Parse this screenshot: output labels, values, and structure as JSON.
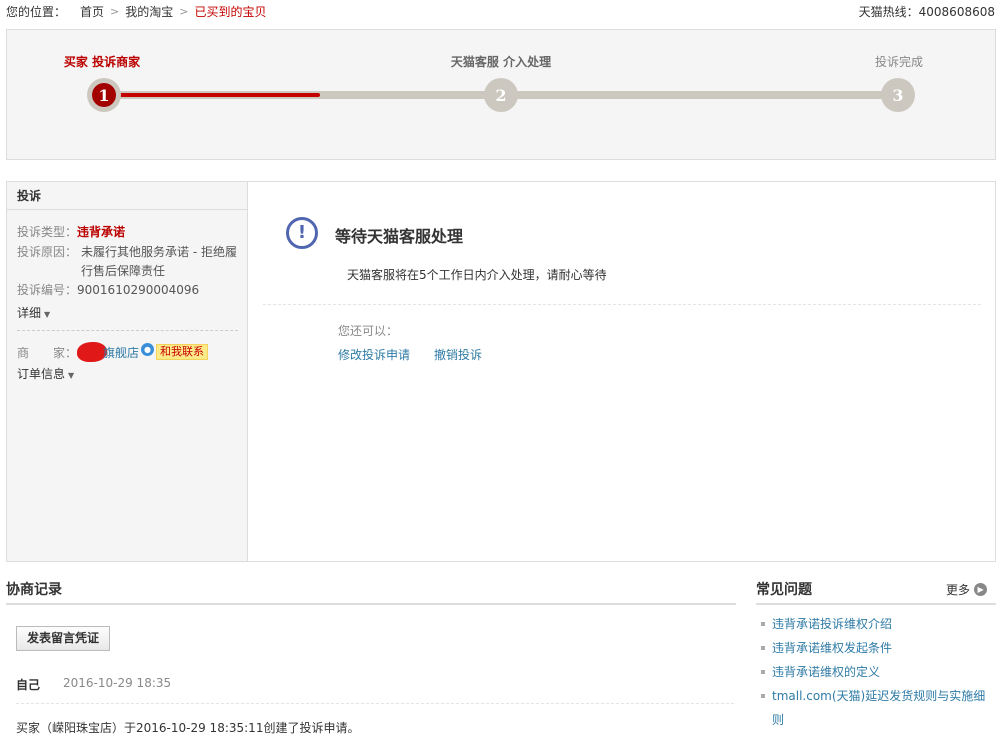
{
  "breadcrumb": {
    "label": "您的位置：",
    "items": [
      "首页",
      "我的淘宝"
    ],
    "current": "已买到的宝贝",
    "separator": ">"
  },
  "hotline": "天猫热线：4008608608",
  "steps": [
    {
      "label": "买家 投诉商家",
      "number": "1",
      "state": "active"
    },
    {
      "label": "天猫客服 介入处理",
      "number": "2",
      "state": "pending"
    },
    {
      "label": "投诉完成",
      "number": "3",
      "state": "pending"
    }
  ],
  "progress_fraction": 0.27,
  "complaint": {
    "header": "投诉",
    "type_label": "投诉类型：",
    "type_value": "违背承诺",
    "reason_label": "投诉原因：",
    "reason_value": "未履行其他服务承诺 - 拒绝履行售后保障责任",
    "id_label": "投诉编号：",
    "id_value": "9001610290004096",
    "details_toggle": "详细",
    "merchant_label": "商　　家：",
    "merchant_name": "旗舰店",
    "contact_button": "和我联系",
    "order_toggle": "订单信息"
  },
  "status": {
    "title": "等待天猫客服处理",
    "subtitle": "天猫客服将在5个工作日内介入处理，请耐心等待",
    "can_do_label": "您还可以：",
    "actions": [
      "修改投诉申请",
      "撤销投诉"
    ]
  },
  "records": {
    "title": "协商记录",
    "post_button": "发表留言凭证",
    "entries": [
      {
        "who": "自己",
        "time": "2016-10-29 18:35",
        "text": "买家（嵘阳珠宝店）于2016-10-29 18:35:11创建了投诉申请。"
      }
    ]
  },
  "faq": {
    "title": "常见问题",
    "more": "更多",
    "items": [
      "违背承诺投诉维权介绍",
      "违背承诺维权发起条件",
      "违背承诺维权的定义",
      "tmall.com(天猫)延迟发货规则与实施细则"
    ]
  },
  "colors": {
    "accent_red": "#c40000",
    "link_blue": "#2f7ba6",
    "status_icon": "#5166b0"
  },
  "icons": {
    "status": "exclamation-circle-icon",
    "chevron": "chevron-down-icon",
    "more": "chevron-right-circle-icon",
    "wangwang": "wangwang-chat-icon"
  }
}
